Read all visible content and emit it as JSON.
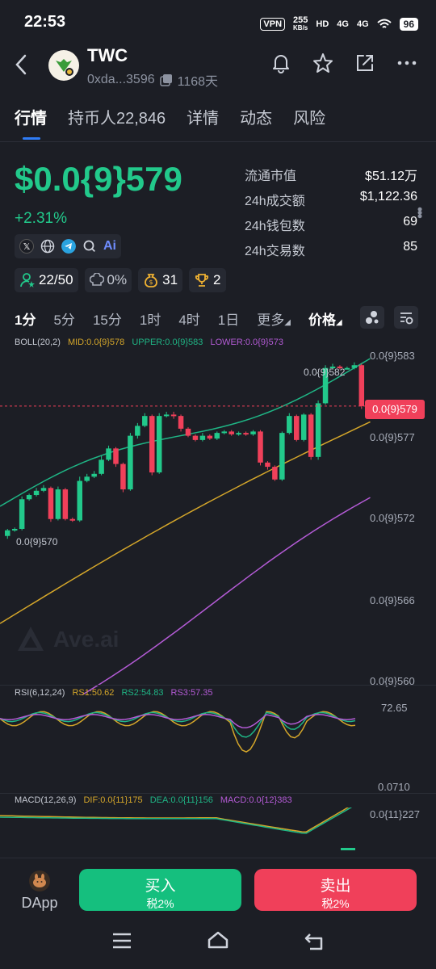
{
  "status_bar": {
    "time": "22:53",
    "vpn": "VPN",
    "net_speed": "255",
    "net_unit": "KB/s",
    "hd": "HD",
    "signal1": "4G",
    "signal2": "4G",
    "battery": "96"
  },
  "header": {
    "title": "TWC",
    "address": "0xda...3596",
    "age": "1168天"
  },
  "tabs": [
    {
      "label": "行情"
    },
    {
      "label": "持币人22,846"
    },
    {
      "label": "详情"
    },
    {
      "label": "动态"
    },
    {
      "label": "风险"
    }
  ],
  "price": {
    "value": "$0.0{9}579",
    "change": "+2.31%"
  },
  "stats": [
    {
      "key": "流通市值",
      "value": "$51.12万"
    },
    {
      "key": "24h成交额",
      "value": "$1,122.36"
    },
    {
      "key": "24h钱包数",
      "value": "69"
    },
    {
      "key": "24h交易数",
      "value": "85"
    }
  ],
  "badges": {
    "holders": "22/50",
    "tax": "0%",
    "money": "31",
    "trophy": "2"
  },
  "intervals": [
    "1分",
    "5分",
    "15分",
    "1时",
    "4时",
    "1日",
    "更多",
    "价格"
  ],
  "indicators": {
    "boll": "BOLL(20,2)",
    "mid": "MID:0.0{9}578",
    "upper": "UPPER:0.0{9}583",
    "lower": "LOWER:0.0{9}573",
    "rsi": "RSI(6,12,24)",
    "rs1": "RS1:50.62",
    "rs2": "RS2:54.83",
    "rs3": "RS3:57.35",
    "macd": "MACD(12,26,9)",
    "dif": "DIF:0.0{11}175",
    "dea": "DEA:0.0{11}156",
    "macd_val": "MACD:0.0{12}383"
  },
  "axis": {
    "p583": "0.0{9}583",
    "p577": "0.0{9}577",
    "p572": "0.0{9}572",
    "p566": "0.0{9}566",
    "p560": "0.0{9}560",
    "current": "0.0{9}579",
    "high": "0.0{9}582",
    "low": "0.0{9}570",
    "rsi_top": "72.65",
    "rsi_bottom": "0.0710",
    "macd_top": "0.0{11}227"
  },
  "watermark": "Ave.ai",
  "bottom": {
    "dapp": "DApp",
    "buy": "买入",
    "buy_tax": "税2%",
    "sell": "卖出",
    "sell_tax": "税2%"
  },
  "colors": {
    "up": "#22c98b",
    "down": "#f0405a",
    "mid": "#d4a62a",
    "upper": "#1fb585",
    "lower": "#b45bd6"
  },
  "chart_data": {
    "type": "candlestick",
    "interval": "1分",
    "candles": [
      {
        "o": 570.2,
        "c": 570.6,
        "h": 570.7,
        "l": 570.0
      },
      {
        "o": 570.6,
        "c": 570.7,
        "h": 570.8,
        "l": 570.5
      },
      {
        "o": 570.7,
        "c": 572.8,
        "h": 573.0,
        "l": 570.6
      },
      {
        "o": 572.8,
        "c": 573.1,
        "h": 573.2,
        "l": 572.7
      },
      {
        "o": 573.1,
        "c": 573.4,
        "h": 573.6,
        "l": 573.0
      },
      {
        "o": 573.4,
        "c": 573.6,
        "h": 573.8,
        "l": 573.3
      },
      {
        "o": 573.6,
        "c": 571.4,
        "h": 573.7,
        "l": 571.2
      },
      {
        "o": 571.4,
        "c": 573.5,
        "h": 573.7,
        "l": 571.3
      },
      {
        "o": 573.5,
        "c": 571.4,
        "h": 573.6,
        "l": 571.3
      },
      {
        "o": 571.4,
        "c": 571.3,
        "h": 571.5,
        "l": 571.2
      },
      {
        "o": 571.3,
        "c": 574.1,
        "h": 574.4,
        "l": 571.2
      },
      {
        "o": 574.1,
        "c": 574.4,
        "h": 574.6,
        "l": 574.0
      },
      {
        "o": 574.4,
        "c": 574.6,
        "h": 574.8,
        "l": 574.3
      },
      {
        "o": 574.6,
        "c": 575.6,
        "h": 575.9,
        "l": 574.5
      },
      {
        "o": 575.6,
        "c": 576.4,
        "h": 576.6,
        "l": 575.5
      },
      {
        "o": 576.4,
        "c": 575.3,
        "h": 576.5,
        "l": 575.1
      },
      {
        "o": 575.3,
        "c": 573.5,
        "h": 575.4,
        "l": 573.3
      },
      {
        "o": 573.5,
        "c": 577.3,
        "h": 577.5,
        "l": 573.4
      },
      {
        "o": 577.3,
        "c": 578.0,
        "h": 578.2,
        "l": 577.1
      },
      {
        "o": 578.0,
        "c": 578.7,
        "h": 578.9,
        "l": 577.9
      },
      {
        "o": 578.7,
        "c": 574.7,
        "h": 578.8,
        "l": 574.5
      },
      {
        "o": 574.7,
        "c": 578.7,
        "h": 578.9,
        "l": 574.6
      },
      {
        "o": 578.7,
        "c": 578.8,
        "h": 579.0,
        "l": 578.6
      },
      {
        "o": 578.8,
        "c": 578.7,
        "h": 579.0,
        "l": 578.5
      },
      {
        "o": 578.7,
        "c": 577.8,
        "h": 578.8,
        "l": 577.6
      },
      {
        "o": 577.8,
        "c": 577.3,
        "h": 577.9,
        "l": 577.2
      },
      {
        "o": 577.3,
        "c": 577.0,
        "h": 577.4,
        "l": 576.9
      },
      {
        "o": 577.0,
        "c": 577.3,
        "h": 577.5,
        "l": 576.9
      },
      {
        "o": 577.3,
        "c": 577.1,
        "h": 577.4,
        "l": 577.0
      },
      {
        "o": 577.1,
        "c": 577.5,
        "h": 577.6,
        "l": 577.0
      },
      {
        "o": 577.5,
        "c": 577.6,
        "h": 577.7,
        "l": 577.4
      },
      {
        "o": 577.6,
        "c": 577.4,
        "h": 577.7,
        "l": 577.3
      },
      {
        "o": 577.4,
        "c": 577.5,
        "h": 577.6,
        "l": 577.3
      },
      {
        "o": 577.5,
        "c": 577.4,
        "h": 577.6,
        "l": 577.3
      },
      {
        "o": 577.4,
        "c": 577.6,
        "h": 577.7,
        "l": 577.3
      },
      {
        "o": 577.6,
        "c": 575.4,
        "h": 577.7,
        "l": 575.2
      },
      {
        "o": 575.4,
        "c": 575.1,
        "h": 575.5,
        "l": 574.9
      },
      {
        "o": 575.1,
        "c": 574.2,
        "h": 575.2,
        "l": 574.1
      },
      {
        "o": 574.2,
        "c": 577.5,
        "h": 577.6,
        "l": 574.1
      },
      {
        "o": 577.5,
        "c": 578.7,
        "h": 578.9,
        "l": 577.4
      },
      {
        "o": 578.7,
        "c": 577.0,
        "h": 578.8,
        "l": 576.9
      },
      {
        "o": 577.0,
        "c": 578.8,
        "h": 578.9,
        "l": 576.9
      },
      {
        "o": 578.8,
        "c": 575.8,
        "h": 578.9,
        "l": 575.6
      },
      {
        "o": 575.8,
        "c": 579.6,
        "h": 579.8,
        "l": 575.6
      },
      {
        "o": 579.6,
        "c": 582.1,
        "h": 582.3,
        "l": 579.5
      },
      {
        "o": 582.1,
        "c": 582.2,
        "h": 582.4,
        "l": 582.0
      },
      {
        "o": 582.2,
        "c": 582.1,
        "h": 582.3,
        "l": 582.0
      },
      {
        "o": 582.1,
        "c": 582.1,
        "h": 582.2,
        "l": 582.0
      },
      {
        "o": 582.1,
        "c": 582.3,
        "h": 582.5,
        "l": 582.0
      },
      {
        "o": 582.3,
        "c": 579.4,
        "h": 582.4,
        "l": 579.2
      }
    ],
    "y_range": [
      560,
      583
    ],
    "y_unit": "0.0{9}"
  }
}
